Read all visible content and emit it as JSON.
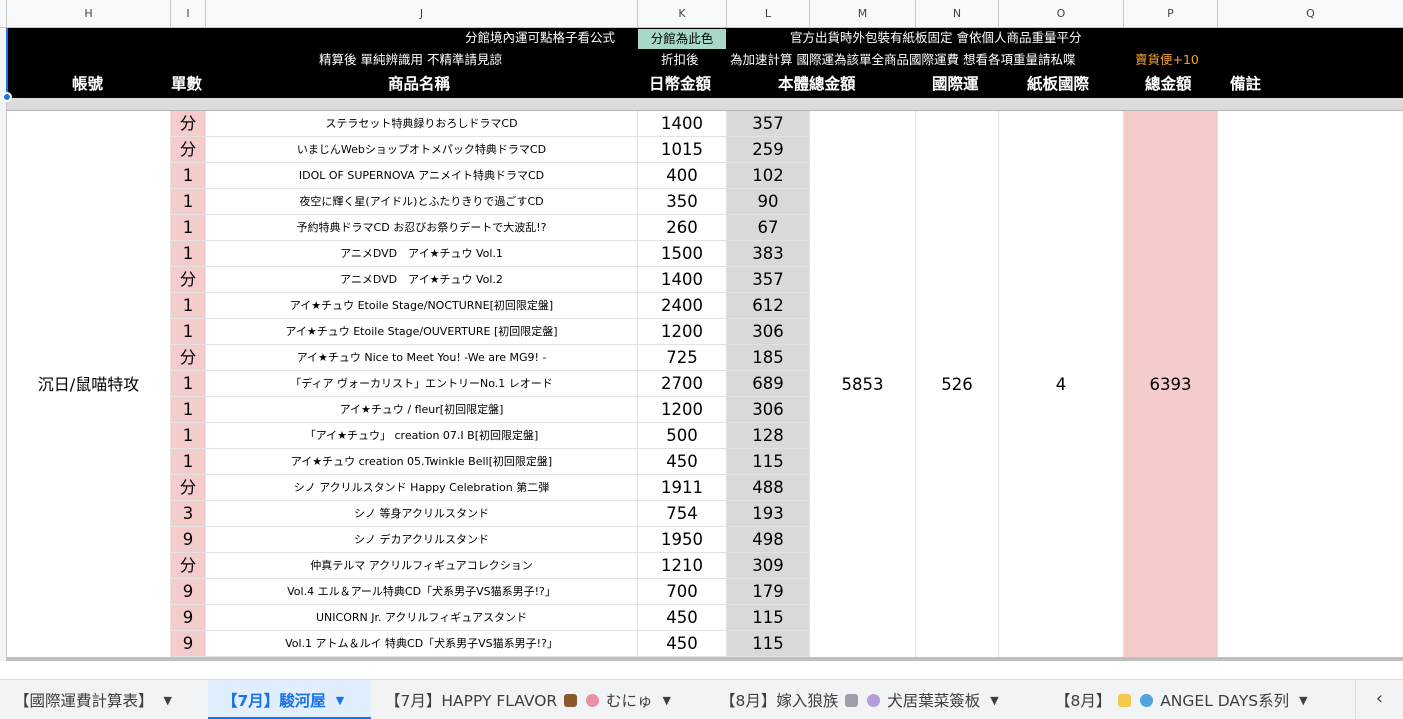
{
  "columns": [
    "H",
    "I",
    "J",
    "K",
    "L",
    "M",
    "N",
    "O",
    "P",
    "Q"
  ],
  "header": {
    "line1_left": "分館境內運可點格子看公式",
    "line1_k": "分館為此色",
    "line1_right": "官方出貨時外包裝有紙板固定 會依個人商品重量平分",
    "line2_j": "精算後 單純辨識用 不精準請見諒",
    "line2_k": "折扣後",
    "line2_right": "為加速計算 國際運為該單全商品國際運費 想看各項重量請私喋",
    "line2_p": "賣貨便+10",
    "labels": {
      "account": "帳號",
      "qty": "單數",
      "name": "商品名稱",
      "jpy": "日幣金額",
      "total": "本體總金額",
      "intl": "國際運",
      "board": "紙板國際",
      "grand": "總金額",
      "note": "備註"
    }
  },
  "summary": {
    "account": "沉日/鼠喵特攻",
    "total": "5853",
    "intl": "526",
    "board": "4",
    "grand": "6393"
  },
  "rows": [
    {
      "qty": "分",
      "name": "ステラセット特典録りおろしドラマCD",
      "jpy": "1400",
      "twd": "357"
    },
    {
      "qty": "分",
      "name": "いまじんWebショップオトメパック特典ドラマCD",
      "jpy": "1015",
      "twd": "259"
    },
    {
      "qty": "1",
      "name": "IDOL OF SUPERNOVA アニメイト特典ドラマCD",
      "jpy": "400",
      "twd": "102"
    },
    {
      "qty": "1",
      "name": "夜空に輝く星(アイドル)とふたりきりで過ごすCD",
      "jpy": "350",
      "twd": "90"
    },
    {
      "qty": "1",
      "name": "予約特典ドラマCD お忍びお祭りデートで大波乱!?",
      "jpy": "260",
      "twd": "67"
    },
    {
      "qty": "1",
      "name": "アニメDVD　アイ★チュウ Vol.1",
      "jpy": "1500",
      "twd": "383"
    },
    {
      "qty": "分",
      "name": "アニメDVD　アイ★チュウ Vol.2",
      "jpy": "1400",
      "twd": "357"
    },
    {
      "qty": "1",
      "name": "アイ★チュウ Etoile Stage/NOCTURNE[初回限定盤]",
      "jpy": "2400",
      "twd": "612"
    },
    {
      "qty": "1",
      "name": "アイ★チュウ Etoile Stage/OUVERTURE [初回限定盤]",
      "jpy": "1200",
      "twd": "306"
    },
    {
      "qty": "分",
      "name": "アイ★チュウ Nice to Meet You! -We are MG9! -",
      "jpy": "725",
      "twd": "185"
    },
    {
      "qty": "1",
      "name": "「ディア ヴォーカリスト」エントリーNo.1 レオード",
      "jpy": "2700",
      "twd": "689"
    },
    {
      "qty": "1",
      "name": "アイ★チュウ / fleur[初回限定盤]",
      "jpy": "1200",
      "twd": "306"
    },
    {
      "qty": "1",
      "name": "「アイ★チュウ」 creation 07.I B[初回限定盤]",
      "jpy": "500",
      "twd": "128"
    },
    {
      "qty": "1",
      "name": "アイ★チュウ creation 05.Twinkle Bell[初回限定盤]",
      "jpy": "450",
      "twd": "115"
    },
    {
      "qty": "分",
      "name": "シノ アクリルスタンド Happy Celebration 第二弾",
      "jpy": "1911",
      "twd": "488"
    },
    {
      "qty": "3",
      "name": "シノ 等身アクリルスタンド",
      "jpy": "754",
      "twd": "193"
    },
    {
      "qty": "9",
      "name": "シノ デカアクリルスタンド",
      "jpy": "1950",
      "twd": "498"
    },
    {
      "qty": "分",
      "name": "仲真テルマ アクリルフィギュアコレクション",
      "jpy": "1210",
      "twd": "309"
    },
    {
      "qty": "9",
      "name": "Vol.4 エル＆アール特典CD「犬系男子VS猫系男子!?」",
      "jpy": "700",
      "twd": "179"
    },
    {
      "qty": "9",
      "name": "UNICORN Jr. アクリルフィギュアスタンド",
      "jpy": "450",
      "twd": "115"
    },
    {
      "qty": "9",
      "name": "Vol.1 アトム＆ルイ 特典CD「犬系男子VS猫系男子!?」",
      "jpy": "450",
      "twd": "115"
    }
  ],
  "tabs": [
    {
      "label": "【國際運費計算表】",
      "active": false
    },
    {
      "label": "【7月】駿河屋",
      "active": true
    },
    {
      "label": "【7月】HAPPY FLAVOR",
      "suffix": "むにゅ",
      "active": false
    },
    {
      "label": "【8月】嫁入狼族",
      "suffix": "犬居葉菜簽板",
      "active": false
    },
    {
      "label": "【8月】",
      "suffix": "ANGEL DAYS系列",
      "active": false
    },
    {
      "label": "【",
      "active": false
    }
  ],
  "tab_nav": "‹",
  "colors": {
    "pink": "#f4cccc",
    "gray": "#d9d9d9",
    "header_bg": "#000000",
    "branch_highlight": "#a8d8c8",
    "accent": "#1a73e8"
  }
}
